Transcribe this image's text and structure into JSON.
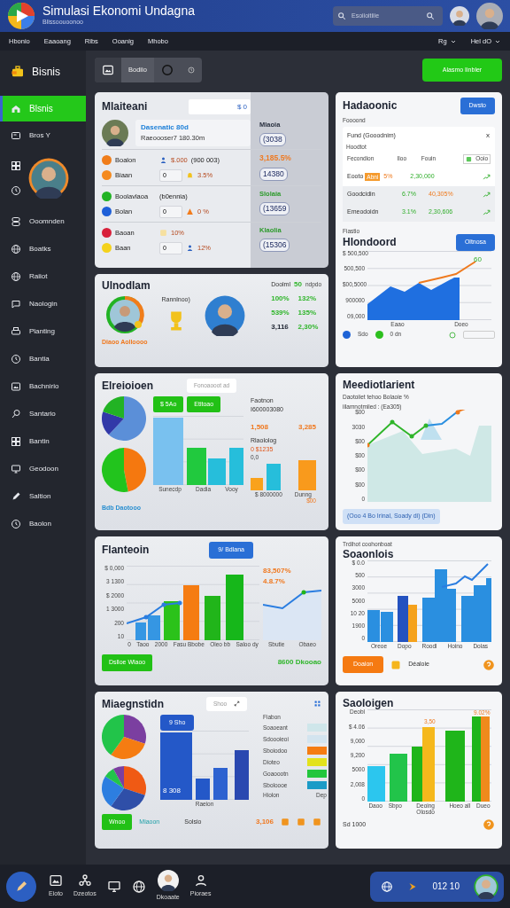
{
  "header": {
    "title": "Simulasi Ekonomi Undagna",
    "subtitle": "Blissoouoonoo",
    "search": {
      "placeholder": "Esoiioitiiie"
    }
  },
  "nav": {
    "links": [
      "Hbonio",
      "Eaaoang",
      "Ribs",
      "Ooanig",
      "Mhobo"
    ],
    "menus": [
      "Rg",
      "Hel dO"
    ]
  },
  "sidebar": {
    "brand": "Bisnis",
    "top_items": [
      {
        "label": "Blsnis",
        "selected": true
      },
      {
        "label": "Bros Y",
        "selected": false
      }
    ],
    "items": [
      {
        "label": "Ooomnden",
        "selected": false
      },
      {
        "label": "Boatks",
        "selected": false
      },
      {
        "label": "Raiiot",
        "selected": false
      },
      {
        "label": "Naologin",
        "selected": false
      },
      {
        "label": "Planting",
        "selected": false
      },
      {
        "label": "Bantia",
        "selected": false
      },
      {
        "label": "Bachnirio",
        "selected": false
      },
      {
        "label": "Santario",
        "selected": false
      },
      {
        "label": "Bantin",
        "selected": false
      },
      {
        "label": "Geodoon",
        "selected": false
      },
      {
        "label": "Saltion",
        "selected": false
      },
      {
        "label": "Baolon",
        "selected": false
      }
    ]
  },
  "toolbar": {
    "segment": "Bodiio",
    "action": "Alasmo Iinbler"
  },
  "left_column": [
    {
      "kind": "profile",
      "title": "Mlaiteani",
      "field": "$ 0",
      "profile": {
        "name": "Dasenatic 80d",
        "detail": "Raeoooser7 180.30m",
        "stats": [
          {
            "text": "Mlaoia",
            "kind": "label"
          },
          {
            "text": "(3038",
            "kind": "value"
          }
        ]
      },
      "groups": [
        {
          "rows": [
            {
              "color": "#f07d1a",
              "label": "Boalon",
              "value": "$.000",
              "note": "(900 003)"
            },
            {
              "color": "#f58a1e",
              "label": "Biaan",
              "field": "0",
              "value": "3.5%"
            }
          ],
          "stats": [
            {
              "text": "3,185.5%",
              "kind": "up"
            },
            {
              "text": "14380",
              "kind": "value"
            }
          ]
        },
        {
          "rows": [
            {
              "color": "#22b324",
              "label": "Boolavlaoa",
              "note": "(b0ennia)"
            },
            {
              "color": "#1e5fd8",
              "label": "Bolan",
              "field": "0",
              "value": "0 %"
            }
          ],
          "stats": [
            {
              "text": "Slolaia",
              "kind": "tag"
            },
            {
              "text": "(13659",
              "kind": "value"
            }
          ]
        },
        {
          "rows": [
            {
              "color": "#d8203a",
              "label": "Baoan",
              "value": "10%"
            },
            {
              "color": "#f4d21c",
              "label": "Baan",
              "field": "0",
              "value": "12%"
            }
          ],
          "stats": [
            {
              "text": "Klaolia",
              "kind": "tag"
            },
            {
              "text": "(15306",
              "kind": "value"
            }
          ]
        }
      ]
    },
    {
      "kind": "ranking",
      "title": "Ulnodlam",
      "caption": "Rannlnoo)",
      "footer": "Diaoo Aolloooo",
      "summary": {
        "label": "Doolml",
        "value": "50",
        "unit": "ndpdo"
      },
      "figures": [
        {
          "text": "100%",
          "kind": "up"
        },
        {
          "text": "132%",
          "kind": "up"
        },
        {
          "text": "539%",
          "kind": "up"
        },
        {
          "text": "135%",
          "kind": "up"
        },
        {
          "text": "3,116",
          "kind": "plain"
        },
        {
          "text": "2,30%",
          "kind": "up"
        }
      ]
    },
    {
      "kind": "pies",
      "title": "Elreioioen",
      "pill": "Fonoaooot ad",
      "buttons": [
        "$ 5Ao",
        "Etitoao"
      ],
      "x_labels": [
        "Sunecdp",
        "Dadia",
        "Vooy"
      ],
      "side": {
        "label": "Faotnon",
        "value": "I600003080",
        "figures": [
          "1,508",
          "3,285"
        ],
        "note": "Rlaololog",
        "alert": "0 $1235",
        "small": "0,0",
        "x_labels": [
          "$ 8000000",
          "Dunng"
        ],
        "tail": "$00"
      },
      "footer": "Bdb Daotooo"
    },
    {
      "kind": "combo",
      "title": "Flanteoin",
      "button": "9/ Bdlana",
      "y_labels": [
        "$ 0,000",
        "3 1300",
        "$ 2000",
        "1 3000",
        "200",
        "10"
      ],
      "x_labels": [
        "0",
        "Taoo",
        "2000",
        "Fasu Bbobe",
        "Oleo bb",
        "Saloo dy"
      ],
      "side": {
        "figures": [
          "83,507%",
          "4.8.7%"
        ],
        "x_labels": [
          "Sbutie",
          "Obaeo"
        ]
      },
      "action": "Dslloe Wlaoo",
      "total": "8600 Dkooao"
    },
    {
      "kind": "mix",
      "title": "Miaegnstidn",
      "field": "Shoo",
      "chip": "9 Sho",
      "bar_value": "8 308",
      "legend_title": "Fiabon",
      "legend": [
        {
          "label": "Soaoeant",
          "color": "#cfe6ea"
        },
        {
          "label": "Sdoooieoi",
          "color": "#d3e4ef"
        },
        {
          "label": "Sboiodoo",
          "color": "#f57c12"
        },
        {
          "label": "Dioteo",
          "color": "#e3e21c"
        },
        {
          "label": "Goaoootn",
          "color": "#22c63c"
        },
        {
          "label": "Sboloooe",
          "color": "#1b9bc7"
        }
      ],
      "x_labels": [
        "Raeion"
      ],
      "legend_x_labels": [
        "Hiolon",
        "Dep"
      ],
      "footer": {
        "badge": "Wnoo",
        "label": "Miaoon",
        "note": "Solsio",
        "total": "3,106"
      }
    }
  ],
  "right_column": [
    {
      "kind": "table",
      "title": "Hadaoonic",
      "button": "Dwsto",
      "caption": "Foooond",
      "filter": "Fund (Gooodnim)",
      "close": "x",
      "subcaption": "Hoodtot",
      "columns": [
        "Fecondion",
        "Iloo",
        "Fouin"
      ],
      "badge": "Ooio",
      "rows": [
        {
          "label": "Eooto",
          "tag": "Abni",
          "share": {
            "text": "5%",
            "kind": "loss"
          },
          "amount": {
            "text": "2,30,000",
            "kind": "gain"
          }
        },
        {
          "label": "Goodcidin",
          "share": {
            "text": "6.7%",
            "kind": "gain"
          },
          "amount": {
            "text": "40,305%",
            "kind": "loss"
          }
        },
        {
          "label": "Emeodoidn",
          "share": {
            "text": "3.1%",
            "kind": "gain"
          },
          "amount": {
            "text": "2,30,606",
            "kind": "gain"
          }
        }
      ],
      "section_caption": "Fiastio",
      "chart_title": "Hlondoord",
      "chart_button": "Oltnosa",
      "y_labels": [
        "$ 500,500",
        "500,500",
        "$00,5000",
        "900000",
        "09,000"
      ],
      "x_labels": [
        "Eaao",
        "Doeo"
      ],
      "point_label": "60",
      "legend": [
        {
          "label": "Sdo",
          "color": "#1e63d6"
        },
        {
          "label": "0 dn",
          "color": "#2cbf1e"
        }
      ]
    },
    {
      "kind": "trend",
      "title": "Meediotlarient",
      "notes": [
        "Daotoiiet tehoo Bolaoie %",
        "iilamnotmiied : (Ea305)"
      ],
      "y_labels": [
        "$00",
        "3030",
        "$00",
        "$00",
        "$00",
        "$00",
        "0"
      ],
      "footer": "(Ooo 4 Bo Irinal, Soady di) (Din)"
    },
    {
      "kind": "bars",
      "caption": "Trdihot coohonboat",
      "title": "Soaonlois",
      "y_labels": [
        "$ 0.0",
        "500",
        "3000",
        "5000",
        "10 20",
        "1900",
        "0"
      ],
      "x_labels": [
        "Oreoe",
        "Dopo",
        "Roodl",
        "Hoino",
        "Dolas"
      ],
      "button": "Doaion",
      "legend": "Déaloie"
    },
    {
      "kind": "growth",
      "title": "Saoloigen",
      "y_labels": [
        "Deobl",
        "$ 4.06",
        "9,000",
        "9,200",
        "5000",
        "2,008",
        "0"
      ],
      "data_labels": [
        "3,50",
        "9.02%"
      ],
      "x_labels": [
        "Daoo",
        "Sbpo",
        "Deoing Olosdo",
        "Hoeo all",
        "Dueo"
      ],
      "footer": "Sd 1000"
    }
  ],
  "taskbar": {
    "apps": [
      {
        "kind": "pen"
      },
      {
        "kind": "photo",
        "label": "Eioto"
      },
      {
        "kind": "network",
        "label": "Dzeotos"
      },
      {
        "kind": "monitor"
      },
      {
        "kind": "globe"
      },
      {
        "kind": "avatar",
        "label": "Dkoaate"
      },
      {
        "kind": "person",
        "label": "Pioraes"
      }
    ],
    "tray": "012 10"
  }
}
